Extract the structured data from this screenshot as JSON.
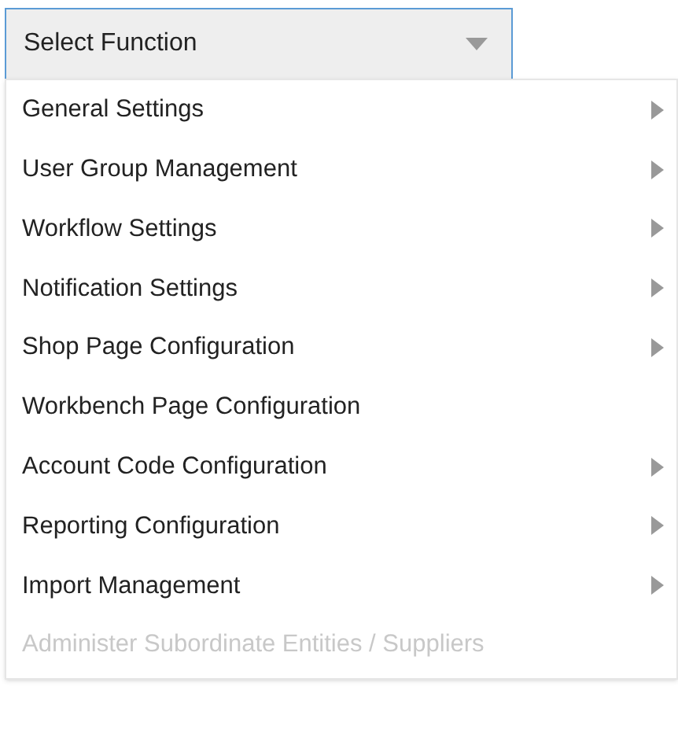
{
  "select": {
    "label": "Select Function",
    "expanded": true
  },
  "menu": {
    "items": [
      {
        "label": "General Settings",
        "has_submenu": true,
        "disabled": false
      },
      {
        "label": "User Group Management",
        "has_submenu": true,
        "disabled": false
      },
      {
        "label": "Workflow Settings",
        "has_submenu": true,
        "disabled": false
      },
      {
        "label": "Notification Settings",
        "has_submenu": true,
        "disabled": false
      },
      {
        "label": "Shop Page Configuration",
        "has_submenu": true,
        "disabled": false
      },
      {
        "label": "Workbench Page Configuration",
        "has_submenu": false,
        "disabled": false
      },
      {
        "label": "Account Code Configuration",
        "has_submenu": true,
        "disabled": false
      },
      {
        "label": "Reporting Configuration",
        "has_submenu": true,
        "disabled": false
      },
      {
        "label": "Import Management",
        "has_submenu": true,
        "disabled": false
      },
      {
        "label": "Administer Subordinate Entities / Suppliers",
        "has_submenu": false,
        "disabled": true
      }
    ]
  }
}
